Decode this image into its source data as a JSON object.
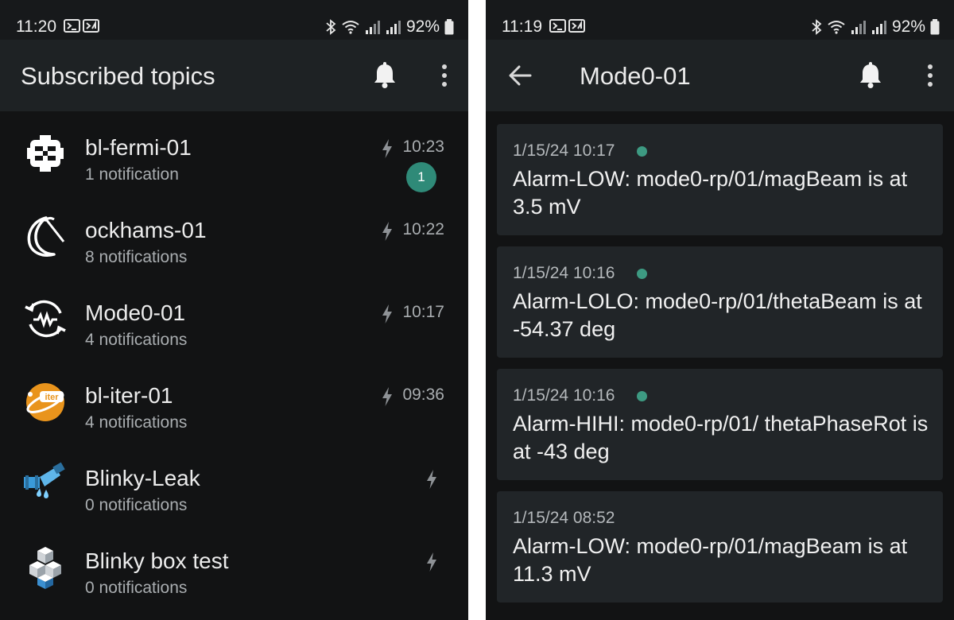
{
  "left_screen": {
    "status_bar": {
      "time": "11:20",
      "battery": "92%"
    },
    "app_bar": {
      "title": "Subscribed topics"
    },
    "topics": [
      {
        "name": "bl-fermi-01",
        "count": "1 notification",
        "time": "10:23",
        "badge": "1",
        "icon": "fermilab-logo-icon"
      },
      {
        "name": "ockhams-01",
        "count": "8 notifications",
        "time": "10:22",
        "badge": "",
        "icon": "razor-logo-icon"
      },
      {
        "name": "Mode0-01",
        "count": "4 notifications",
        "time": "10:17",
        "badge": "",
        "icon": "waveform-cycle-icon"
      },
      {
        "name": "bl-iter-01",
        "count": "4 notifications",
        "time": "09:36",
        "badge": "",
        "icon": "iter-logo-icon"
      },
      {
        "name": "Blinky-Leak",
        "count": "0 notifications",
        "time": "",
        "badge": "",
        "icon": "leaking-pipe-icon"
      },
      {
        "name": "Blinky box test",
        "count": "0 notifications",
        "time": "",
        "badge": "",
        "icon": "stacked-cubes-icon"
      }
    ]
  },
  "right_screen": {
    "status_bar": {
      "time": "11:19",
      "battery": "92%"
    },
    "app_bar": {
      "title": "Mode0-01"
    },
    "notifications": [
      {
        "date": "1/15/24 10:17",
        "new": true,
        "message": "Alarm-LOW: mode0-rp/01/magBeam is at 3.5 mV"
      },
      {
        "date": "1/15/24 10:16",
        "new": true,
        "message": "Alarm-LOLO: mode0-rp/01/thetaBeam is at -54.37 deg"
      },
      {
        "date": "1/15/24 10:16",
        "new": true,
        "message": "Alarm-HIHI: mode0-rp/01/ thetaPhaseRot is at -43 deg"
      },
      {
        "date": "1/15/24 08:52",
        "new": false,
        "message": "Alarm-LOW: mode0-rp/01/magBeam is at 11.3 mV"
      }
    ]
  },
  "colors": {
    "background": "#121314",
    "app_bar": "#1e2224",
    "card": "#212528",
    "accent_badge": "#2f8a78",
    "unread_dot": "#3d9a82"
  }
}
